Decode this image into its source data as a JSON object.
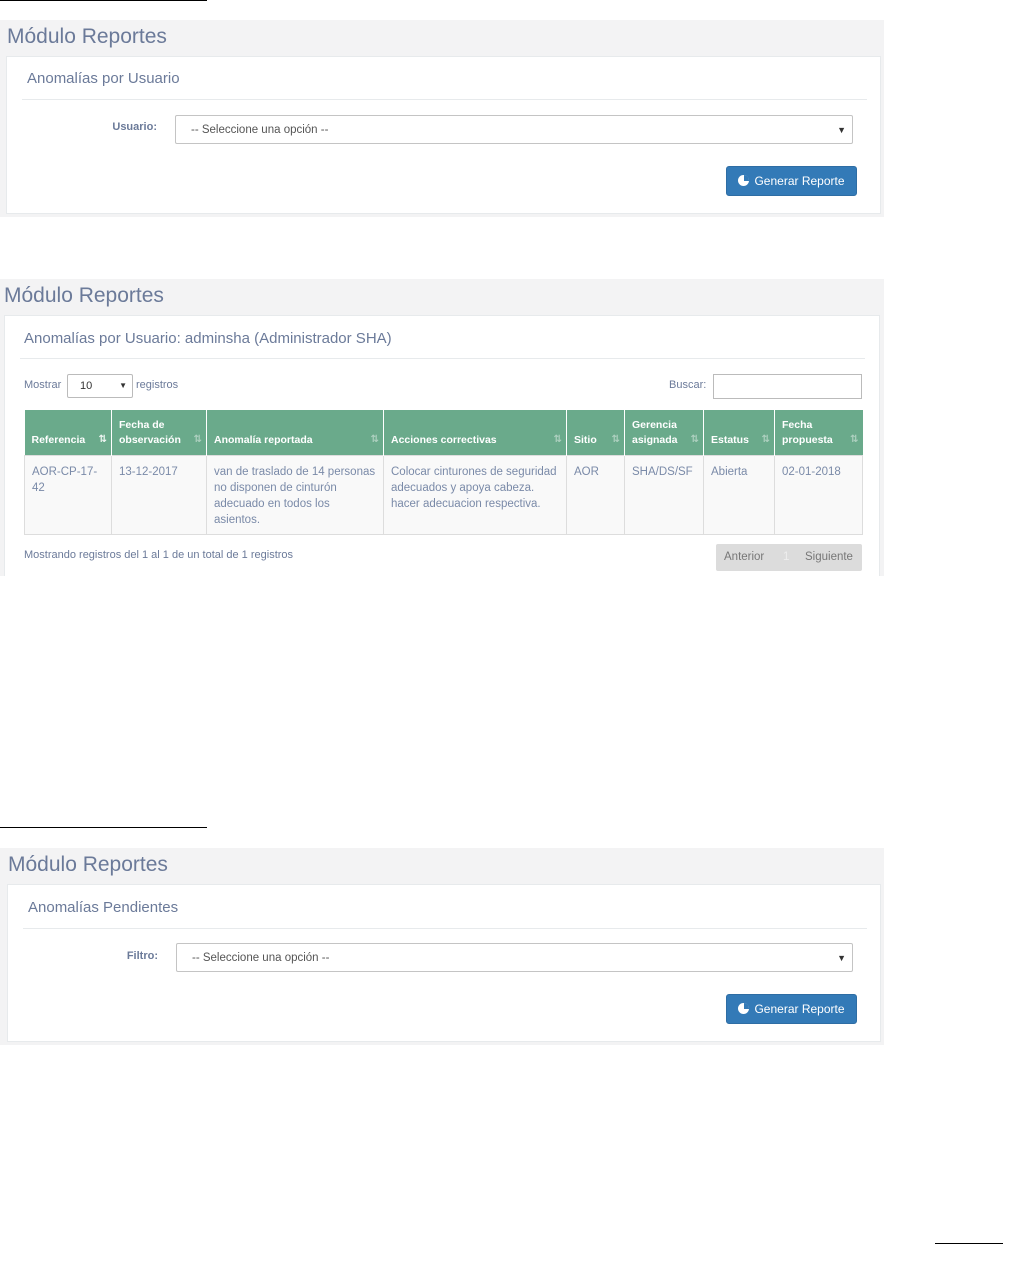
{
  "section1": {
    "module_title": "Módulo Reportes",
    "panel_title": "Anomalías por Usuario",
    "field_label": "Usuario:",
    "select_value": "-- Seleccione una opción --",
    "button_label": "Generar Reporte"
  },
  "section2": {
    "module_title": "Módulo Reportes",
    "panel_title": "Anomalías por Usuario: adminsha (Administrador SHA)",
    "show_label": "Mostrar",
    "show_value": "10",
    "records_label": "registros",
    "search_label": "Buscar:",
    "search_value": "",
    "columns": [
      "Referencia",
      "Fecha de observación",
      "Anomalía reportada",
      "Acciones correctivas",
      "Sitio",
      "Gerencia asignada",
      "Estatus",
      "Fecha propuesta"
    ],
    "rows": [
      [
        "AOR-CP-17-42",
        "13-12-2017",
        "van de traslado de 14 personas no disponen de cinturón adecuado en todos los asientos.",
        "Colocar cinturones de seguridad adecuados y apoya cabeza. hacer adecuacion respectiva.",
        "AOR",
        "SHA/DS/SF",
        "Abierta",
        "02-01-2018"
      ]
    ],
    "info_text": "Mostrando registros del 1 al 1 de un total de 1 registros",
    "pager": {
      "previous": "Anterior",
      "page": "1",
      "next": "Siguiente"
    }
  },
  "section3": {
    "module_title": "Módulo Reportes",
    "panel_title": "Anomalías Pendientes",
    "field_label": "Filtro:",
    "select_value": "-- Seleccione una opción --",
    "button_label": "Generar Reporte"
  },
  "icons": {
    "dropdown": "dropdown-arrow-icon",
    "report": "pie-chart-icon",
    "sort": "sort-icon"
  },
  "colors": {
    "primary_button": "#337ab7",
    "table_header": "#6aaa8b",
    "module_title": "#6b7a99"
  }
}
